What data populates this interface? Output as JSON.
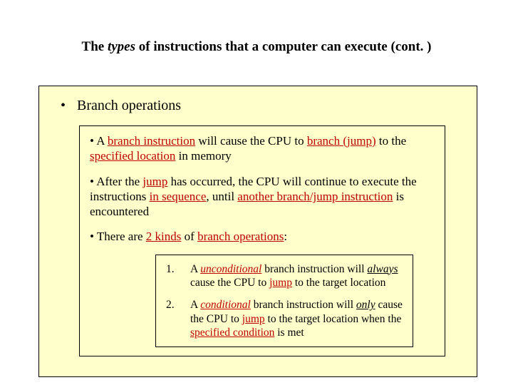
{
  "title": {
    "pre": "The ",
    "italic": "types",
    "post": " of instructions that a computer can execute (cont. )"
  },
  "main_bullet_dot": "•",
  "main_bullet": "Branch operations",
  "inner": {
    "p1_bullet": "• A ",
    "p1_r1": "branch instruction",
    "p1_mid1": " will cause the CPU to ",
    "p1_r2": "branch (jump)",
    "p1_mid2": " to the ",
    "p1_r3": "specified location",
    "p1_end": " in memory",
    "p2_bullet": "• After the ",
    "p2_r1": "jump",
    "p2_mid1": " has occurred, the CPU will continue to execute the instructions ",
    "p2_r2": "in sequence",
    "p2_mid2": ", until ",
    "p2_r3": "another branch/jump instruction",
    "p2_end": " is encountered",
    "p3_bullet": "• There are ",
    "p3_r1": "2 kinds",
    "p3_mid": " of ",
    "p3_r2": "branch operations",
    "p3_end": ":"
  },
  "kinds": {
    "row1": {
      "num": "1.",
      "t1": "A ",
      "red1_i_u": "unconditional",
      "t2": " branch instruction will ",
      "i_u": "always",
      "t3": " cause the CPU to ",
      "red2": "jump",
      "t4": " to the target location"
    },
    "row2": {
      "num": "2.",
      "t1": "A ",
      "red1_i_u": "conditional",
      "t2": " branch instruction will ",
      "i_u": "only",
      "t3": " cause the CPU to ",
      "red2": "jump",
      "t4": " to the target location when the ",
      "red3_u": "specified condition",
      "t5": " is met"
    }
  }
}
